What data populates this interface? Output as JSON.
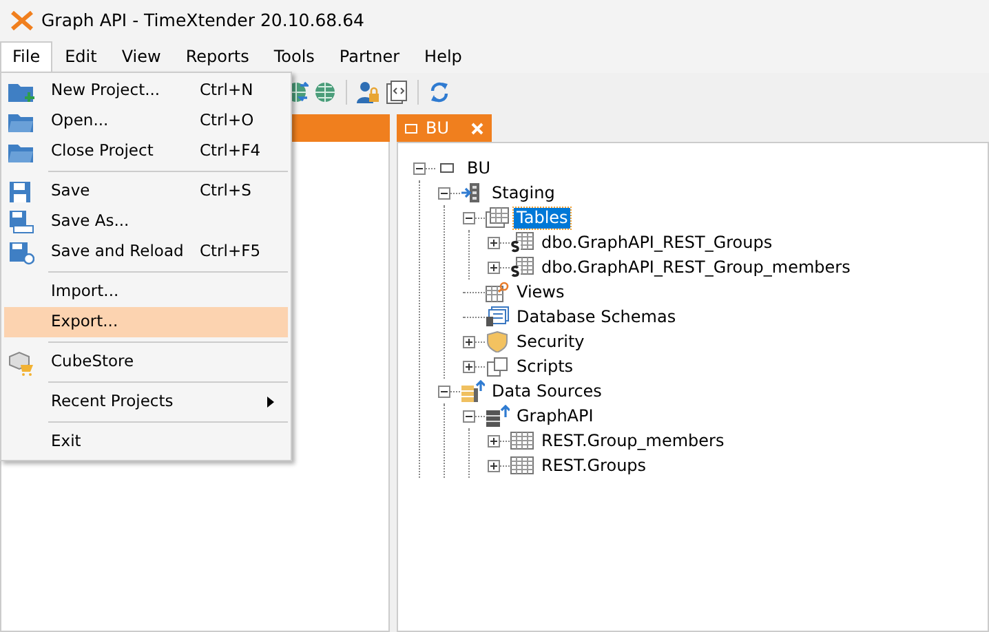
{
  "window": {
    "title": "Graph API - TimeXtender 20.10.68.64"
  },
  "menu_bar": [
    {
      "label": "File",
      "selected": true
    },
    {
      "label": "Edit",
      "selected": false
    },
    {
      "label": "View",
      "selected": false
    },
    {
      "label": "Reports",
      "selected": false
    },
    {
      "label": "Tools",
      "selected": false
    },
    {
      "label": "Partner",
      "selected": false
    },
    {
      "label": "Help",
      "selected": false
    }
  ],
  "toolbar": [
    {
      "kind": "globe-arrows"
    },
    {
      "kind": "globe"
    },
    {
      "kind": "separator"
    },
    {
      "kind": "user-lock"
    },
    {
      "kind": "script"
    },
    {
      "kind": "separator"
    },
    {
      "kind": "refresh"
    }
  ],
  "file_menu": [
    {
      "kind": "item",
      "label": "New Project...",
      "shortcut": "Ctrl+N",
      "selected": false
    },
    {
      "kind": "item",
      "label": "Open...",
      "shortcut": "Ctrl+O",
      "selected": false
    },
    {
      "kind": "item",
      "label": "Close Project",
      "shortcut": "Ctrl+F4",
      "selected": false
    },
    {
      "kind": "separator"
    },
    {
      "kind": "item",
      "label": "Save",
      "shortcut": "Ctrl+S",
      "selected": false
    },
    {
      "kind": "item",
      "label": "Save As...",
      "selected": false
    },
    {
      "kind": "item",
      "label": "Save and Reload",
      "shortcut": "Ctrl+F5",
      "selected": false
    },
    {
      "kind": "separator"
    },
    {
      "kind": "item",
      "label": "Import...",
      "selected": false
    },
    {
      "kind": "item",
      "label": "Export...",
      "selected": true
    },
    {
      "kind": "separator"
    },
    {
      "kind": "item",
      "label": "CubeStore",
      "selected": false
    },
    {
      "kind": "separator"
    },
    {
      "kind": "submenu",
      "label": "Recent Projects",
      "selected": false
    },
    {
      "kind": "separator"
    },
    {
      "kind": "item",
      "label": "Exit",
      "selected": false
    }
  ],
  "document_tab": {
    "label": "BU"
  },
  "tree": [
    {
      "label": "BU",
      "kind": "project",
      "expanded": true,
      "selected": false,
      "children": [
        {
          "label": "Staging",
          "kind": "staging",
          "expanded": true,
          "selected": false,
          "children": [
            {
              "label": "Tables",
              "kind": "tables",
              "expanded": true,
              "selected": true,
              "children": [
                {
                  "label": "dbo.GraphAPI_REST_Groups",
                  "kind": "stable",
                  "expanded": false,
                  "selected": false
                },
                {
                  "label": "dbo.GraphAPI_REST_Group_members",
                  "kind": "stable",
                  "expanded": false,
                  "selected": false
                }
              ]
            },
            {
              "label": "Views",
              "kind": "views",
              "selected": false
            },
            {
              "label": "Database Schemas",
              "kind": "schemas",
              "selected": false
            },
            {
              "label": "Security",
              "kind": "security",
              "expanded": false,
              "selected": false
            },
            {
              "label": "Scripts",
              "kind": "scripts",
              "expanded": false,
              "selected": false
            }
          ]
        },
        {
          "label": "Data Sources",
          "kind": "sources",
          "expanded": true,
          "selected": false,
          "children": [
            {
              "label": "GraphAPI",
              "kind": "source",
              "expanded": true,
              "selected": false,
              "children": [
                {
                  "label": "REST.Group_members",
                  "kind": "table",
                  "expanded": false,
                  "selected": false
                },
                {
                  "label": "REST.Groups",
                  "kind": "table",
                  "expanded": false,
                  "selected": false
                }
              ]
            }
          ]
        }
      ]
    }
  ]
}
